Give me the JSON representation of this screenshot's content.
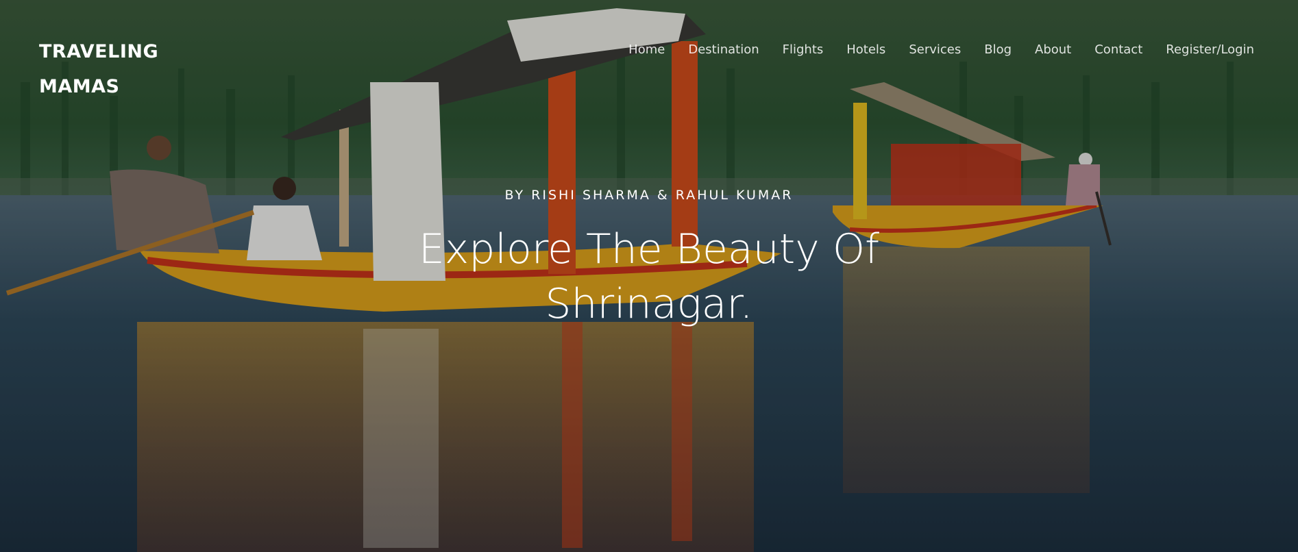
{
  "brand": {
    "line1": "TRAVELING",
    "line2": "MAMAS"
  },
  "nav": {
    "items": [
      {
        "label": "Home"
      },
      {
        "label": "Destination"
      },
      {
        "label": "Flights"
      },
      {
        "label": "Hotels"
      },
      {
        "label": "Services"
      },
      {
        "label": "Blog"
      },
      {
        "label": "About"
      },
      {
        "label": "Contact"
      },
      {
        "label": "Register/Login"
      }
    ]
  },
  "hero": {
    "byline": "BY RISHI SHARMA & RAHUL KUMAR",
    "title_line1": "Explore The Beauty Of",
    "title_line2": "Shrinagar."
  },
  "colors": {
    "text": "#ffffff",
    "boat_yellow": "#e0a51c",
    "boat_red": "#c8321a",
    "water": "#2b4a5a",
    "forest": "#2f5a35"
  }
}
